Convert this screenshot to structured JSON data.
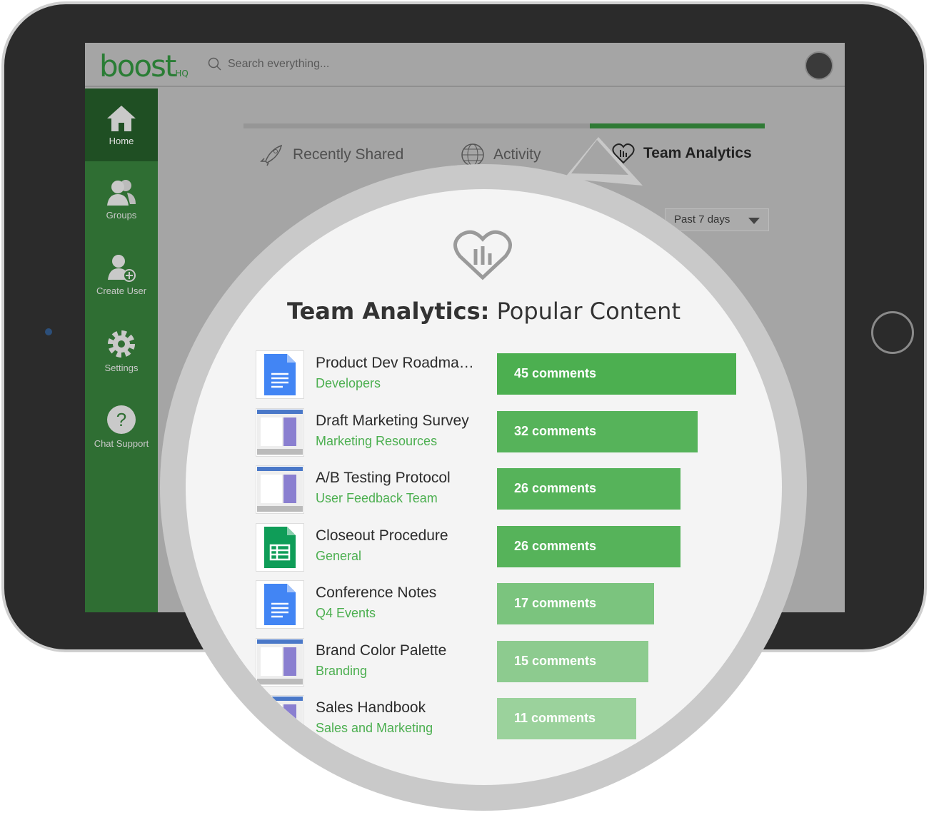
{
  "app": {
    "logo": "boost",
    "logo_suffix": "HQ",
    "search_placeholder": "Search everything..."
  },
  "sidebar": {
    "items": [
      {
        "label": "Home",
        "icon": "home-icon",
        "active": true
      },
      {
        "label": "Groups",
        "icon": "groups-icon"
      },
      {
        "label": "Create User",
        "icon": "create-user-icon"
      },
      {
        "label": "Settings",
        "icon": "gear-icon"
      },
      {
        "label": "Chat Support",
        "icon": "question-icon"
      }
    ]
  },
  "tabs": [
    {
      "label": "Recently Shared",
      "icon": "rocket-icon"
    },
    {
      "label": "Activity",
      "icon": "globe-icon"
    },
    {
      "label": "Team Analytics",
      "icon": "heart-chart-icon",
      "active": true
    }
  ],
  "filter": {
    "selected": "Past 7 days"
  },
  "panel": {
    "title_bold": "Team Analytics:",
    "title_rest": "Popular Content"
  },
  "items": [
    {
      "name": "Product Dev Roadma…",
      "group": "Developers",
      "comments": 45,
      "label": "45 comments",
      "thumb": "google-doc",
      "color": "#4caf50"
    },
    {
      "name": "Draft Marketing Survey",
      "group": "Marketing Resources",
      "comments": 32,
      "label": "32 comments",
      "thumb": "screenshot",
      "color": "#56b35a"
    },
    {
      "name": "A/B Testing Protocol",
      "group": "User Feedback Team",
      "comments": 26,
      "label": "26 comments",
      "thumb": "screenshot",
      "color": "#56b35a"
    },
    {
      "name": "Closeout Procedure",
      "group": "General",
      "comments": 26,
      "label": "26 comments",
      "thumb": "google-sheet",
      "color": "#56b35a"
    },
    {
      "name": "Conference Notes",
      "group": "Q4 Events",
      "comments": 17,
      "label": "17 comments",
      "thumb": "google-doc",
      "color": "#7bc47e"
    },
    {
      "name": "Brand Color Palette",
      "group": "Branding",
      "comments": 15,
      "label": "15 comments",
      "thumb": "screenshot",
      "color": "#8dcb8f"
    },
    {
      "name": "Sales Handbook",
      "group": "Sales and Marketing",
      "comments": 11,
      "label": "11 comments",
      "thumb": "screenshot",
      "color": "#9bd29c"
    }
  ]
}
